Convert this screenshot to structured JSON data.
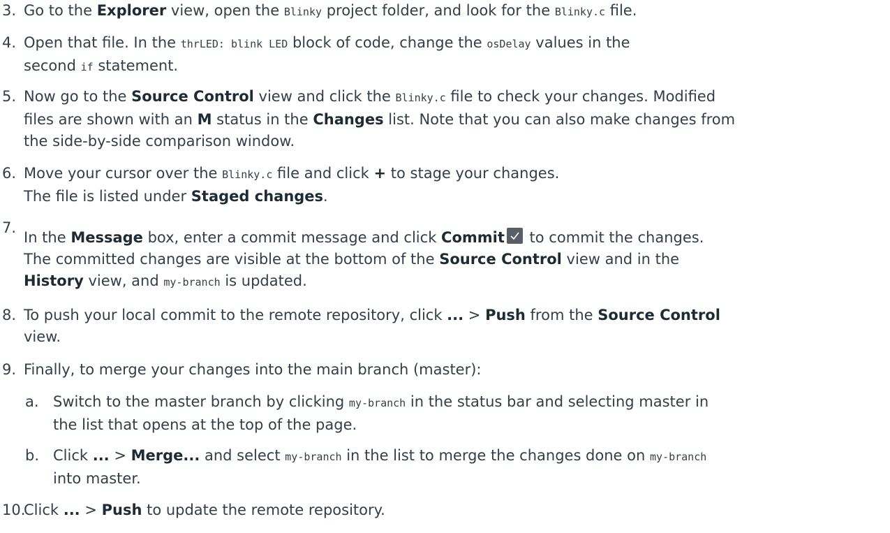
{
  "steps": [
    {
      "num": "3.",
      "lines": [
        [
          {
            "t": "Go to the "
          },
          {
            "t": "Explorer",
            "b": true
          },
          {
            "t": " view, open the "
          },
          {
            "t": "Blinky",
            "c": true
          },
          {
            "t": " project folder, and look for the "
          },
          {
            "t": "Blinky.c",
            "c": true
          },
          {
            "t": " file."
          }
        ]
      ]
    },
    {
      "num": "4.",
      "lines": [
        [
          {
            "t": "Open that file. In the "
          },
          {
            "t": "thrLED: blink LED",
            "c": true
          },
          {
            "t": " block of code, change the "
          },
          {
            "t": "osDelay",
            "c": true
          },
          {
            "t": " values in the"
          }
        ],
        [
          {
            "t": "second "
          },
          {
            "t": "if",
            "c": true
          },
          {
            "t": " statement."
          }
        ]
      ]
    },
    {
      "num": "5.",
      "lines": [
        [
          {
            "t": "Now go to the "
          },
          {
            "t": "Source Control",
            "b": true
          },
          {
            "t": " view and click the "
          },
          {
            "t": "Blinky.c",
            "c": true
          },
          {
            "t": " file to check your changes. Modified"
          }
        ],
        [
          {
            "t": "files are shown with an "
          },
          {
            "t": "M",
            "b": true
          },
          {
            "t": " status in the "
          },
          {
            "t": "Changes",
            "b": true
          },
          {
            "t": " list. Note that you can also make changes from"
          }
        ],
        [
          {
            "t": "the side-by-side comparison window."
          }
        ]
      ]
    },
    {
      "num": "6.",
      "lines": [
        [
          {
            "t": "Move your cursor over the "
          },
          {
            "t": "Blinky.c",
            "c": true
          },
          {
            "t": " file and click "
          },
          {
            "t": "+",
            "b": true
          },
          {
            "t": " to stage your changes."
          }
        ],
        [
          {
            "t": "The file is listed under "
          },
          {
            "t": "Staged changes",
            "b": true
          },
          {
            "t": "."
          }
        ]
      ]
    },
    {
      "num": "7.",
      "lines": [
        [
          {
            "t": "In the "
          },
          {
            "t": "Message",
            "b": true
          },
          {
            "t": " box, enter a commit message and click "
          },
          {
            "t": "Commit",
            "b": true
          },
          {
            "icon": "commit-check-icon"
          },
          {
            "t": " to commit the changes."
          }
        ],
        [
          {
            "t": "The committed changes are visible at the bottom of the "
          },
          {
            "t": "Source Control",
            "b": true
          },
          {
            "t": " view and in the"
          }
        ],
        [
          {
            "t": "History",
            "b": true
          },
          {
            "t": " view, and "
          },
          {
            "t": "my-branch",
            "c": true
          },
          {
            "t": " is updated."
          }
        ]
      ]
    },
    {
      "num": "8.",
      "lines": [
        [
          {
            "t": "To push your local commit to the remote repository, click "
          },
          {
            "t": "...",
            "b": true
          },
          {
            "t": " > "
          },
          {
            "t": "Push",
            "b": true
          },
          {
            "t": " from the "
          },
          {
            "t": "Source Control",
            "b": true
          }
        ],
        [
          {
            "t": "view."
          }
        ]
      ]
    },
    {
      "num": "9.",
      "lines": [
        [
          {
            "t": "Finally, to merge your changes into the main branch (master):"
          }
        ]
      ]
    },
    {
      "num": "a.",
      "sub": true,
      "lines": [
        [
          {
            "t": "Switch to the master branch by clicking "
          },
          {
            "t": "my-branch",
            "c": true
          },
          {
            "t": " in the status bar and selecting master in"
          }
        ],
        [
          {
            "t": "the list that opens at the top of the page."
          }
        ]
      ]
    },
    {
      "num": "b.",
      "sub": true,
      "lines": [
        [
          {
            "t": "Click "
          },
          {
            "t": "...",
            "b": true
          },
          {
            "t": " > "
          },
          {
            "t": "Merge...",
            "b": true
          },
          {
            "t": " and select "
          },
          {
            "t": "my-branch",
            "c": true
          },
          {
            "t": " in the list to merge the changes done on "
          },
          {
            "t": "my-branch",
            "c": true
          }
        ],
        [
          {
            "t": "into master."
          }
        ]
      ]
    },
    {
      "num": "10.",
      "lines": [
        [
          {
            "t": "Click "
          },
          {
            "t": "...",
            "b": true
          },
          {
            "t": " > "
          },
          {
            "t": "Push",
            "b": true
          },
          {
            "t": " to update the remote repository."
          }
        ]
      ]
    }
  ]
}
